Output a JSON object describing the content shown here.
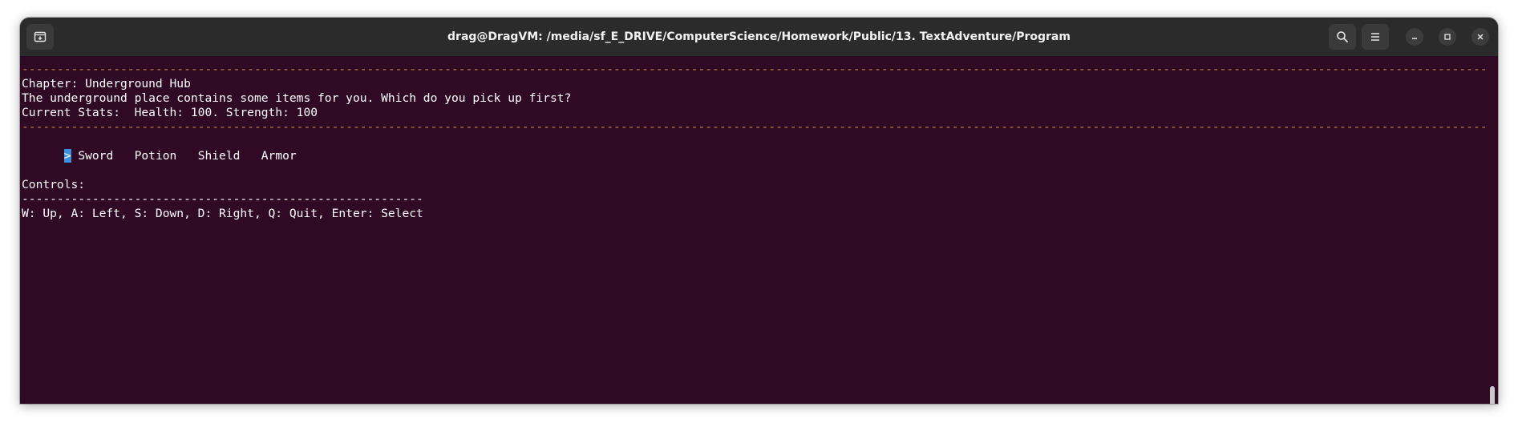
{
  "window": {
    "title": "drag@DragVM: /media/sf_E_DRIVE/ComputerScience/Homework/Public/13. TextAdventure/Program"
  },
  "titlebar": {
    "new_tab_icon": "new-tab-icon",
    "search_icon": "search-icon",
    "menu_icon": "hamburger-menu-icon",
    "minimize_icon": "minimize-icon",
    "maximize_icon": "maximize-icon",
    "close_icon": "close-icon"
  },
  "terminal": {
    "separator": "----------------------------------------------------------------------------------------------------------------------------------------------------------------------------------------------------------------------------------------------------------------------------------",
    "chapter": "Chapter: Underground Hub",
    "description": "The underground place contains some items for you. Which do you pick up first?",
    "stats": "Current Stats:  Health: 100. Strength: 100",
    "cursor": ">",
    "options": [
      "Sword",
      "Potion",
      "Shield",
      "Armor"
    ],
    "controls_header": "Controls:",
    "controls_separator": "---------------------------------------------------------",
    "controls": "W: Up, A: Left, S: Down, D: Right, Q: Quit, Enter: Select"
  },
  "colors": {
    "terminal_bg": "#300a24",
    "titlebar_bg": "#2b2b2b",
    "separator": "#c98a2e",
    "cursor": "#3b8fdc"
  }
}
